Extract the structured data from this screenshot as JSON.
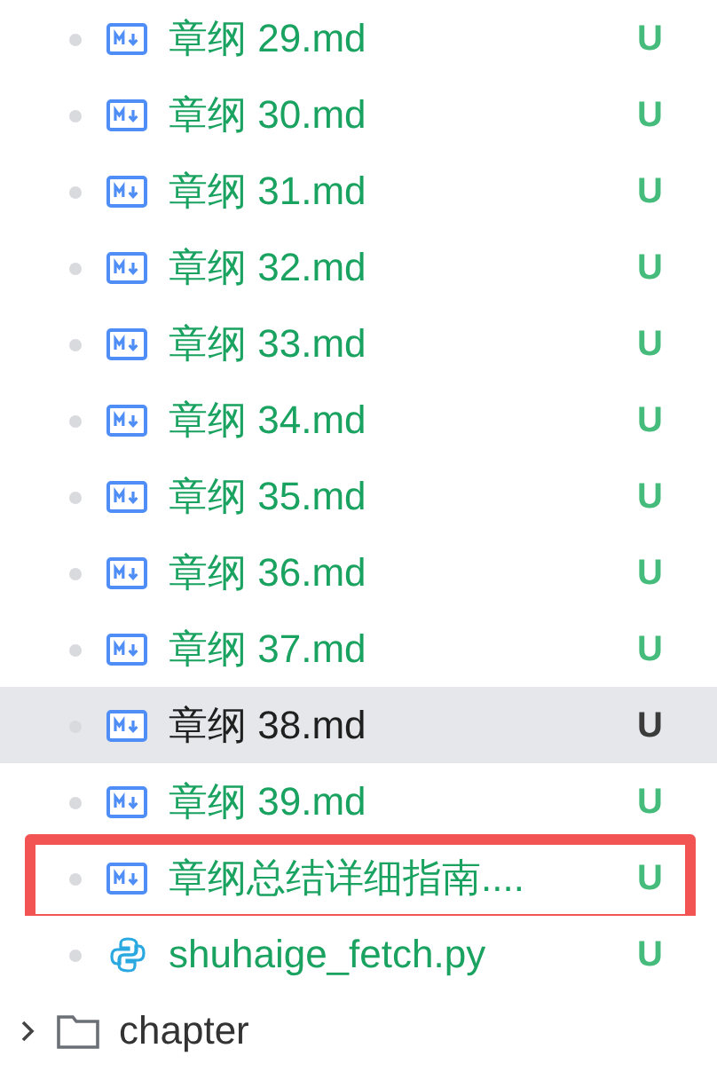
{
  "files": [
    {
      "name": "章纲 29.md",
      "kind": "md",
      "status": "U",
      "selected": false,
      "highlighted": false
    },
    {
      "name": "章纲 30.md",
      "kind": "md",
      "status": "U",
      "selected": false,
      "highlighted": false
    },
    {
      "name": "章纲 31.md",
      "kind": "md",
      "status": "U",
      "selected": false,
      "highlighted": false
    },
    {
      "name": "章纲 32.md",
      "kind": "md",
      "status": "U",
      "selected": false,
      "highlighted": false
    },
    {
      "name": "章纲 33.md",
      "kind": "md",
      "status": "U",
      "selected": false,
      "highlighted": false
    },
    {
      "name": "章纲 34.md",
      "kind": "md",
      "status": "U",
      "selected": false,
      "highlighted": false
    },
    {
      "name": "章纲 35.md",
      "kind": "md",
      "status": "U",
      "selected": false,
      "highlighted": false
    },
    {
      "name": "章纲 36.md",
      "kind": "md",
      "status": "U",
      "selected": false,
      "highlighted": false
    },
    {
      "name": "章纲 37.md",
      "kind": "md",
      "status": "U",
      "selected": false,
      "highlighted": false
    },
    {
      "name": "章纲 38.md",
      "kind": "md",
      "status": "U",
      "selected": true,
      "highlighted": false
    },
    {
      "name": "章纲 39.md",
      "kind": "md",
      "status": "U",
      "selected": false,
      "highlighted": false
    },
    {
      "name": "章纲总结详细指南....",
      "kind": "md",
      "status": "U",
      "selected": false,
      "highlighted": true
    },
    {
      "name": "shuhaige_fetch.py",
      "kind": "py",
      "status": "U",
      "selected": false,
      "highlighted": false
    }
  ],
  "folders": [
    {
      "name": "chapter",
      "expanded": false
    }
  ]
}
